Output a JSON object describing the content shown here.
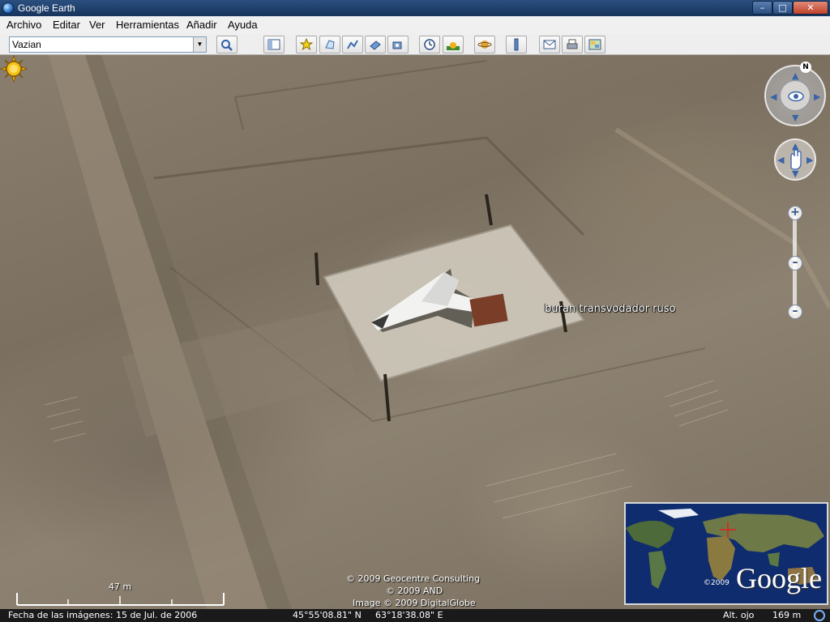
{
  "window": {
    "title": "Google Earth"
  },
  "menu": [
    "Archivo",
    "Editar",
    "Ver",
    "Herramientas",
    "Añadir",
    "Ayuda"
  ],
  "search": {
    "value": "Vazian"
  },
  "toolbar_icons": [
    "sidebar-icon",
    "placemark-icon",
    "polygon-icon",
    "path-icon",
    "image-overlay-icon",
    "record-tour-icon",
    "historical-imagery-icon",
    "sunlight-icon",
    "planets-icon",
    "ruler-icon",
    "email-icon",
    "print-icon",
    "google-maps-icon"
  ],
  "map": {
    "placemark_label": "buran transvodador ruso",
    "north_label": "N",
    "scale_label": "47 m",
    "copyright": [
      "© 2009 Geocentre Consulting",
      "© 2009 AND",
      "Image © 2009 DigitalGlobe"
    ],
    "overview": {
      "brand": "Google",
      "year": "©2009"
    }
  },
  "status": {
    "image_date": "Fecha de las imágenes: 15 de Jul. de 2006",
    "lat": "45°55'08.81\" N",
    "lon": "63°18'38.08\" E",
    "alt_label": "Alt. ojo",
    "alt_value": "169 m"
  },
  "colors": {
    "titlebar": "#1f4270",
    "placemark": "#f5b800",
    "overview_water": "#0e2a6a"
  }
}
